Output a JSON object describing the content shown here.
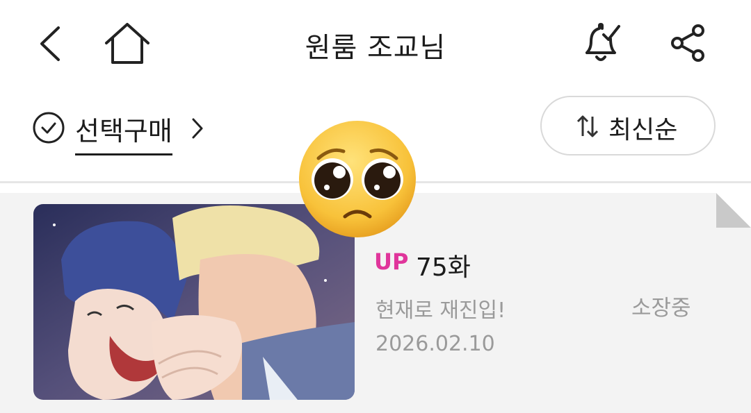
{
  "header": {
    "title": "원룸 조교님",
    "icons": [
      "back-icon",
      "home-icon",
      "bell-check-icon",
      "share-icon"
    ]
  },
  "toolbar": {
    "select_buy_label": "선택구매",
    "sort_label": "최신순"
  },
  "episodes": [
    {
      "badge": "UP",
      "number": "75화",
      "title": "현재로 재진입!",
      "date": "2026.02.10",
      "status": "소장중"
    }
  ],
  "overlay": {
    "emoji": "pleading-face"
  },
  "colors": {
    "accent": "#e0359b",
    "secondary_text": "#9a9a9a",
    "row_bg": "#f3f3f3"
  }
}
